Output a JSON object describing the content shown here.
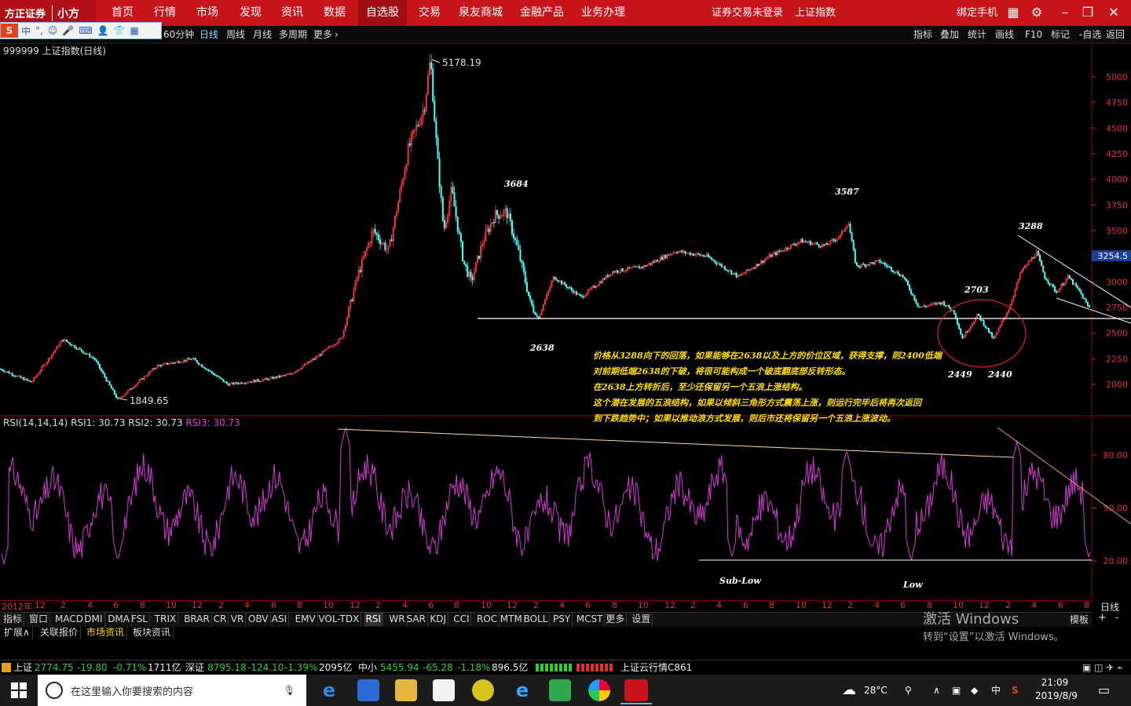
{
  "app": {
    "brand": "方正证券",
    "product": "小方",
    "menu": [
      "首页",
      "行情",
      "市场",
      "发现",
      "资讯",
      "数据",
      "自选股",
      "交易",
      "泉友商城",
      "金融产品",
      "业务办理"
    ],
    "active_menu": "自选股",
    "login_status": "证券交易未登录",
    "index_name": "上证指数",
    "bind_phone": "绑定手机"
  },
  "ime": {
    "logo": "S",
    "mode": "中"
  },
  "toolbar": {
    "periods": [
      "60分钟",
      "日线",
      "周线",
      "月线",
      "多周期",
      "更多"
    ],
    "active_period": "日线",
    "right": [
      "指标",
      "叠加",
      "统计",
      "画线",
      "F10",
      "标记",
      "-自选",
      "返回"
    ]
  },
  "chart": {
    "title": "999999 上证指数(日线)",
    "price_ticks": [
      "5000",
      "4750",
      "4500",
      "4250",
      "4000",
      "3750",
      "3500",
      "3250",
      "3000",
      "2750",
      "2500",
      "2250",
      "2000"
    ],
    "current_price": "3254.5",
    "high_label": "5178.19",
    "low_label": "1849.65",
    "annotations": [
      "3684",
      "3587",
      "3288",
      "2703",
      "2638",
      "2449",
      "2440"
    ],
    "analysis_text": [
      "价格从3288向下的回落，如果能够在2638以及上方的价位区域，获得支撑，则2400低端",
      "对前期低端2638的下破，将很可能构成一个破底翻底部反转形态。",
      "在2638上方转折后，至少还保留另一个五浪上涨结构。",
      "这个潜在发展的五浪结构，如果以倾斜三角形方式震荡上涨，则运行完毕后将再次返回",
      "到下跌趋势中；如果以推动浪方式发展，则后市还将保留另一个五浪上涨波动。"
    ]
  },
  "rsi": {
    "title": "RSI(14,14,14)",
    "rsi1": "RSI1: 30.73",
    "rsi2": "RSI2: 30.73",
    "rsi3": "RSI3: 30.73",
    "ticks": [
      "80.00",
      "50.00",
      "20.00"
    ],
    "labels": [
      "Sub-Low",
      "Low"
    ]
  },
  "date_axis": {
    "year": "2012年",
    "months": [
      "12",
      "2",
      "4",
      "6",
      "8",
      "10",
      "12",
      "2",
      "4",
      "6",
      "8",
      "10",
      "12",
      "2",
      "4",
      "6",
      "8",
      "10",
      "12",
      "2",
      "4",
      "6",
      "8",
      "10",
      "12",
      "2",
      "4",
      "6",
      "8",
      "10",
      "12",
      "2",
      "4",
      "6",
      "8",
      "10",
      "12",
      "2",
      "4",
      "6",
      "8"
    ],
    "period": "日线"
  },
  "indicators": [
    "指标",
    "窗口",
    "MACD",
    "DMI",
    "DMA",
    "FSL",
    "TRIX",
    "BRAR",
    "CR",
    "VR",
    "OBV",
    "ASI",
    "EMV",
    "VOL-TDX",
    "RSI",
    "WR",
    "SAR",
    "KDJ",
    "CCI",
    "ROC",
    "MTM",
    "BOLL",
    "PSY",
    "MCST",
    "更多",
    "设置"
  ],
  "active_indicator": "RSI",
  "subtabs": [
    "扩展∧",
    "关联报价",
    "市场资讯",
    "板块资讯"
  ],
  "active_subtab": "市场资讯",
  "template_label": "模板",
  "activate_windows": {
    "line1": "激活 Windows",
    "line2": "转到“设置”以激活 Windows。"
  },
  "status": {
    "sh": {
      "name": "上证",
      "price": "2774.75",
      "chg": "-19.80",
      "pct": "-0.71%",
      "amt": "1711亿"
    },
    "sz": {
      "name": "深证",
      "price": "8795.18",
      "chg": "-124.10",
      "pct": "-1.39%",
      "amt": "2095亿"
    },
    "zx": {
      "name": "中小",
      "price": "5455.94",
      "chg": "-65.28",
      "pct": "-1.18%",
      "amt": "896.5亿"
    },
    "server": "上证云行情C861"
  },
  "taskbar": {
    "search_placeholder": "在这里输入你要搜索的内容",
    "weather": "28°C",
    "ime": "中",
    "time": "21:09",
    "date": "2019/8/9"
  }
}
